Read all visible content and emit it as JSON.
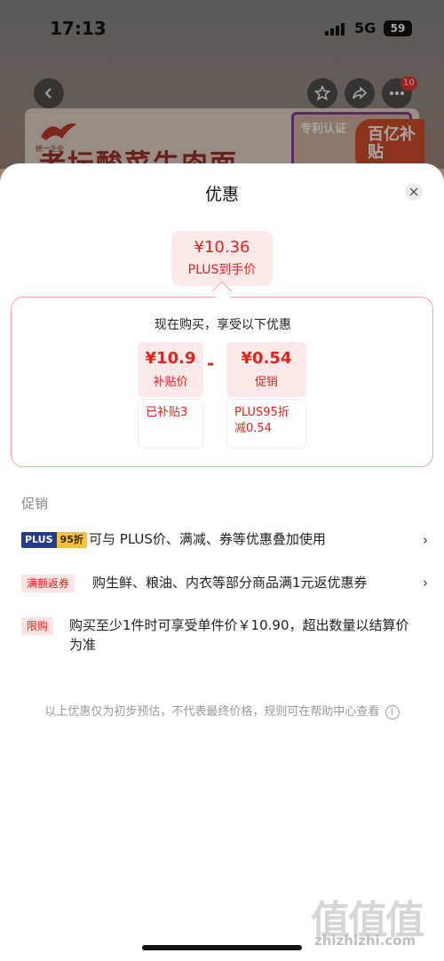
{
  "status_bar": {
    "time": "17:13",
    "network": "5G",
    "battery": "59"
  },
  "background": {
    "nav_badge_count": "10",
    "product_title": "老坛酸菜牛肉面",
    "brand_text": "统一企业",
    "cert_label": "专利认证",
    "badge_text": "百亿补贴"
  },
  "sheet": {
    "title": "优惠",
    "final_price": {
      "amount": "¥10.36",
      "label": "PLUS到手价"
    },
    "breakdown": {
      "title": "现在购买，享受以下优惠",
      "left": {
        "amount": "¥10.9",
        "label": "补贴价",
        "sub": "已补贴3"
      },
      "operator": "-",
      "right": {
        "amount": "¥0.54",
        "label": "促销",
        "sub": "PLUS95折减0.54"
      }
    },
    "section_label": "促销",
    "promos": [
      {
        "tag_a": "PLUS",
        "tag_b": "95折",
        "text": "可与 PLUS价、满减、券等优惠叠加使用",
        "arrow": "›"
      },
      {
        "tag": "满额返券",
        "text": "购生鲜、粮油、内衣等部分商品满1元返优惠券",
        "arrow": "›"
      },
      {
        "tag": "限购",
        "text": "购买至少1件时可享受单件价￥10.90，超出数量以结算价为准"
      }
    ],
    "footnote": "以上优惠仅为初步预估，不代表最终价格，规则可在帮助中心查看",
    "info_icon": "i"
  },
  "watermark": {
    "glyphs": "值值值",
    "text": "zhizhizhi.com"
  },
  "colors": {
    "accent": "#e2231a",
    "accent_bg": "#fde9e9",
    "plus_blue": "#233c8c",
    "plus_gold": "#f5c044"
  }
}
